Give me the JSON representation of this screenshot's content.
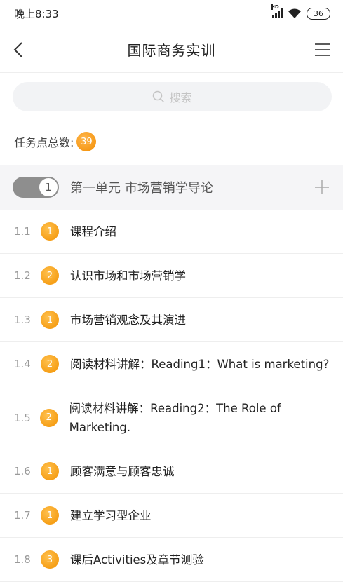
{
  "status_bar": {
    "time": "晚上8:33",
    "network": "HD",
    "battery": "36"
  },
  "navbar": {
    "title": "国际商务实训"
  },
  "search": {
    "placeholder": "搜索"
  },
  "task_points": {
    "label": "任务点总数:",
    "total": "39"
  },
  "unit": {
    "toggle_value": "1",
    "title": "第一单元 市场营销学导论"
  },
  "lessons": [
    {
      "num": "1.1",
      "tasks": "1",
      "title": "课程介绍"
    },
    {
      "num": "1.2",
      "tasks": "2",
      "title": "认识市场和市场营销学"
    },
    {
      "num": "1.3",
      "tasks": "1",
      "title": "市场营销观念及其演进"
    },
    {
      "num": "1.4",
      "tasks": "2",
      "title": "阅读材料讲解：Reading1：What is marketing?"
    },
    {
      "num": "1.5",
      "tasks": "2",
      "title": "阅读材料讲解：Reading2：The Role of Marketing."
    },
    {
      "num": "1.6",
      "tasks": "1",
      "title": "顾客满意与顾客忠诚"
    },
    {
      "num": "1.7",
      "tasks": "1",
      "title": "建立学习型企业"
    },
    {
      "num": "1.8",
      "tasks": "3",
      "title": "课后Activities及章节测验"
    }
  ],
  "colors": {
    "badge": "#f29100",
    "toggle": "#8e8e8e",
    "unit_bg": "#f5f5f7"
  }
}
